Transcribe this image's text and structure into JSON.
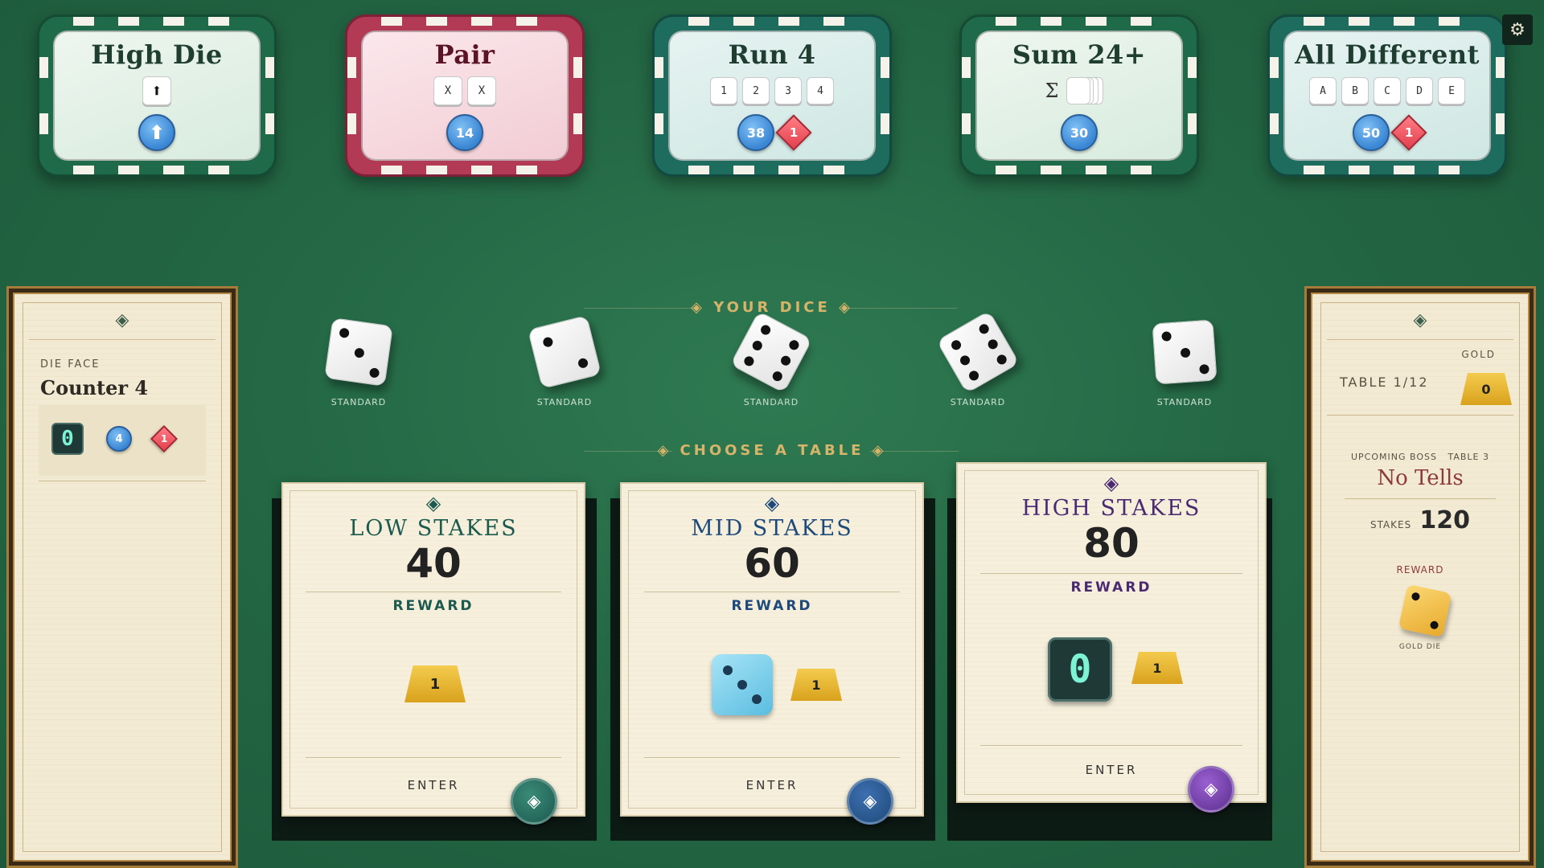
{
  "scoring_chips": [
    {
      "title": "High Die",
      "symbol": "⬆",
      "tokens": []
    },
    {
      "title": "Pair",
      "tiles": [
        "X",
        "X"
      ],
      "token": "14"
    },
    {
      "title": "Run 4",
      "tiles": [
        "1",
        "2",
        "3",
        "4"
      ],
      "token": "38",
      "diamond": "1"
    },
    {
      "title": "Sum 24+",
      "sigma": "Σ",
      "token": "30"
    },
    {
      "title": "All Different",
      "tiles": [
        "A",
        "B",
        "C",
        "D",
        "E"
      ],
      "token": "50",
      "diamond": "1"
    }
  ],
  "settings": {
    "icon": "gear-icon",
    "glyph": "⚙"
  },
  "left_panel": {
    "label": "DIE FACE",
    "title": "Counter 4",
    "seg_value": "0",
    "token": "4",
    "diamond": "1"
  },
  "dice_tray": {
    "heading": "YOUR DICE",
    "dice": [
      {
        "label": "STANDARD",
        "face": 3
      },
      {
        "label": "STANDARD",
        "face": 2
      },
      {
        "label": "STANDARD",
        "face": 6
      },
      {
        "label": "STANDARD",
        "face": 6
      },
      {
        "label": "STANDARD",
        "face": 3
      }
    ]
  },
  "tables_heading": "CHOOSE A TABLE",
  "tables": [
    {
      "title": "LOW STAKES",
      "value": "40",
      "reward_label": "REWARD",
      "gold": "1",
      "enter": "ENTER",
      "color": "#1c5a4f"
    },
    {
      "title": "MID STAKES",
      "value": "60",
      "reward_label": "REWARD",
      "gold": "1",
      "enter": "ENTER",
      "color": "#1d4a7a"
    },
    {
      "title": "HIGH STAKES",
      "value": "80",
      "reward_label": "REWARD",
      "gold": "1",
      "seg": "0",
      "enter": "ENTER",
      "color": "#4a2a72"
    }
  ],
  "right_panel": {
    "table_label": "TABLE 1/12",
    "gold_label": "GOLD",
    "gold_value": "0",
    "upcoming_label": "UPCOMING BOSS",
    "boss_table": "TABLE 3",
    "boss_name": "No Tells",
    "stakes_label": "STAKES",
    "stakes_value": "120",
    "reward_label": "REWARD",
    "reward_item": "GOLD DIE"
  }
}
